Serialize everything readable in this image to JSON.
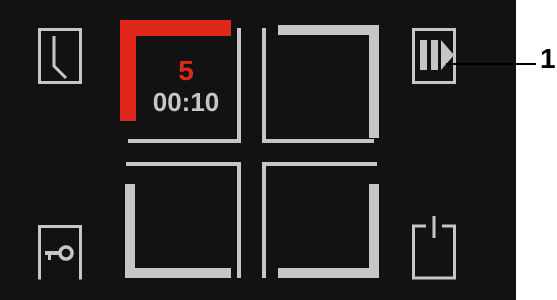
{
  "colors": {
    "background": "#121212",
    "icon_gray": "#c6c6c6",
    "active_red": "#e0271c",
    "callout": "#000000"
  },
  "icons": {
    "clock": "clock-icon",
    "pause_play": "pause-play-icon",
    "key_lock": "key-lock-icon",
    "power": "power-icon"
  },
  "zones": [
    {
      "id": "front-left",
      "active": true,
      "level": "5",
      "timer": "00:10"
    },
    {
      "id": "front-right",
      "active": false,
      "level": "",
      "timer": ""
    },
    {
      "id": "rear-left",
      "active": false,
      "level": "",
      "timer": ""
    },
    {
      "id": "rear-right",
      "active": false,
      "level": "",
      "timer": ""
    }
  ],
  "callout": {
    "number": "1"
  }
}
